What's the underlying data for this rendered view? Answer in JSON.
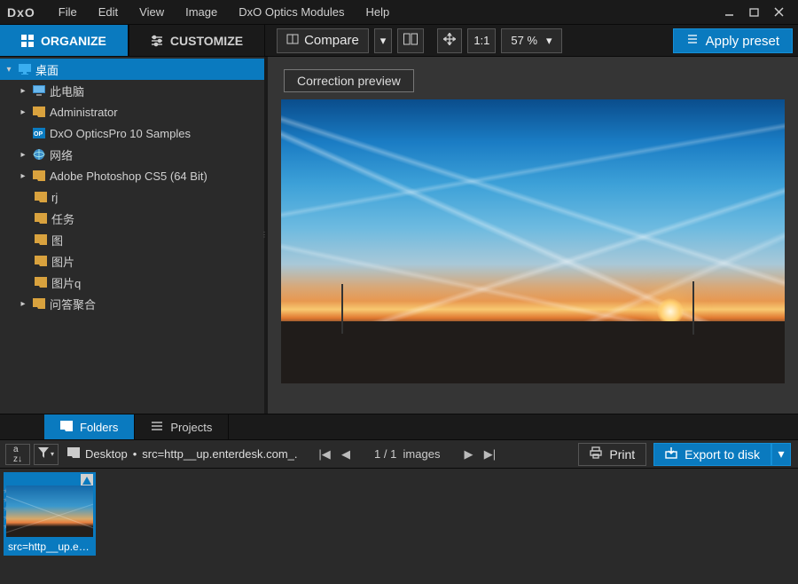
{
  "brand": "DxO",
  "menu": {
    "file": "File",
    "edit": "Edit",
    "view": "View",
    "image": "Image",
    "optics": "DxO Optics Modules",
    "help": "Help"
  },
  "tabs": {
    "organize": "ORGANIZE",
    "customize": "CUSTOMIZE"
  },
  "toolbar": {
    "compare": "Compare",
    "ratio": "1:1",
    "zoom": "57 %",
    "apply_preset": "Apply preset"
  },
  "tree": {
    "root": "桌面",
    "items": [
      {
        "label": "此电脑"
      },
      {
        "label": "Administrator"
      },
      {
        "label": "DxO OpticsPro 10 Samples"
      },
      {
        "label": "网络"
      },
      {
        "label": "Adobe Photoshop CS5 (64 Bit)"
      },
      {
        "label": "rj"
      },
      {
        "label": "任务"
      },
      {
        "label": "图"
      },
      {
        "label": "图片"
      },
      {
        "label": "图片q"
      },
      {
        "label": "问答聚合"
      }
    ]
  },
  "preview": {
    "correction": "Correction preview"
  },
  "bottom_tabs": {
    "folders": "Folders",
    "projects": "Projects"
  },
  "breadcrumb": {
    "root": "Desktop",
    "sep": "•",
    "path": "src=http__up.enterdesk.com_..."
  },
  "pager": {
    "count": "1 / 1",
    "suffix": "images"
  },
  "actions": {
    "print": "Print",
    "export": "Export to disk"
  },
  "thumb": {
    "label": "src=http__up.en..."
  }
}
